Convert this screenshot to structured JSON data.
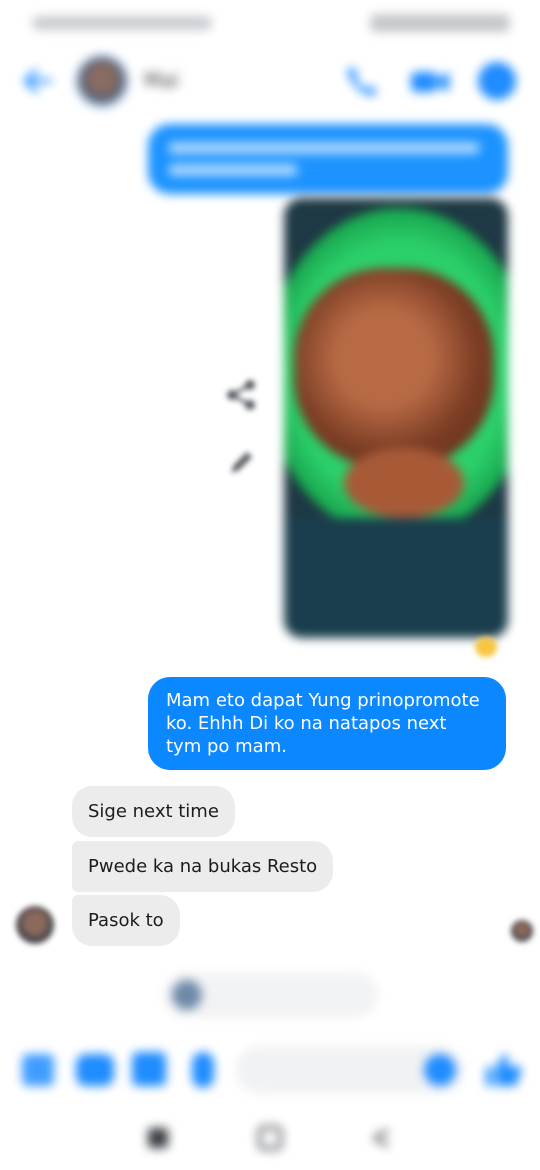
{
  "header": {
    "contact_name": "Mai"
  },
  "messages": {
    "outgoing_main": "Mam eto dapat Yung prinopromote ko. Ehhh Di ko na natapos next tym po mam.",
    "incoming": [
      {
        "text": "Sige next time"
      },
      {
        "text": "Pwede ka na bukas Resto"
      },
      {
        "text": "Pasok to"
      }
    ]
  },
  "icons": {
    "back": "back-arrow-icon",
    "call": "phone-icon",
    "video": "video-camera-icon",
    "info": "info-icon",
    "share": "share-icon",
    "edit": "pencil-icon",
    "reaction": "emoji-reaction-icon",
    "like": "thumbs-up-icon"
  },
  "colors": {
    "accent": "#0b87ff",
    "incoming_bubble": "#ececec"
  }
}
